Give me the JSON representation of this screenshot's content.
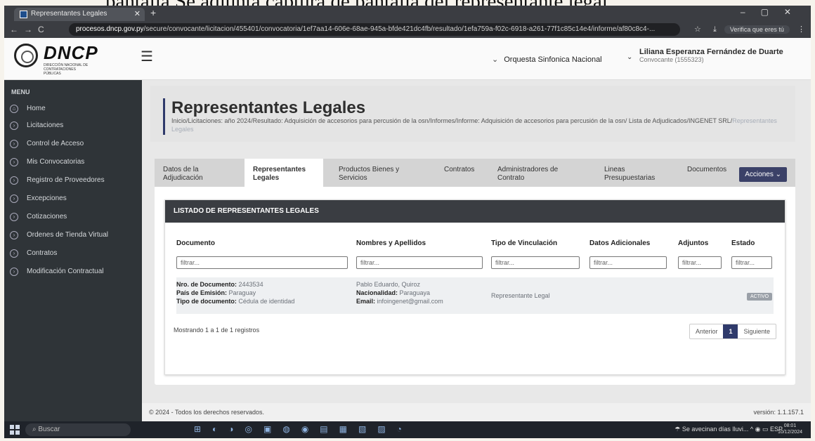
{
  "doc_heading": "pantalla Se adjunta captura de pantalla del representante legal",
  "browser": {
    "tab_title": "Representantes Legales",
    "url_host": "procesos.dncp.gov.py",
    "url_path": "/secure/convocante/licitacion/455401/convocatoria/1ef7aa14-606e-68ae-945a-bfde421dc4fb/resultado/1efa759a-f02c-6918-a261-77f1c85c14e4/informe/af80c8c4-...",
    "verify_label": "Verifica que eres tú"
  },
  "header": {
    "brand": "DNCP",
    "brand_sub": "DIRECCIÓN NACIONAL DE CONTRATACIONES PÚBLICAS",
    "org": "Orquesta Sinfonica Nacional",
    "user_name": "Liliana Esperanza Fernández de Duarte",
    "user_role": "Convocante (1555323)"
  },
  "sidebar": {
    "title": "MENU",
    "items": [
      {
        "label": "Home"
      },
      {
        "label": "Licitaciones"
      },
      {
        "label": "Control de Acceso"
      },
      {
        "label": "Mis Convocatorias"
      },
      {
        "label": "Registro de Proveedores"
      },
      {
        "label": "Excepciones"
      },
      {
        "label": "Cotizaciones"
      },
      {
        "label": "Ordenes de Tienda Virtual"
      },
      {
        "label": "Contratos"
      },
      {
        "label": "Modificación Contractual"
      }
    ]
  },
  "page": {
    "title": "Representantes Legales",
    "breadcrumb": "Inicio/Licitaciones: año 2024/Resultado: Adquisición de accesorios para percusión de la osn/Informes/Informe: Adquisición de accesorios para percusión de la osn/ Lista de Adjudicados/INGENET SRL/",
    "breadcrumb_current": "Representantes Legales"
  },
  "tabs": [
    {
      "label": "Datos de la Adjudicación"
    },
    {
      "label": "Representantes Legales"
    },
    {
      "label": "Productos Bienes y Servicios"
    },
    {
      "label": "Contratos"
    },
    {
      "label": "Administradores de Contrato"
    },
    {
      "label": "Lineas Presupuestarias"
    },
    {
      "label": "Documentos"
    }
  ],
  "actions_label": "Acciones",
  "list": {
    "title": "LISTADO DE REPRESENTANTES LEGALES",
    "columns": [
      "Documento",
      "Nombres y Apellidos",
      "Tipo de Vinculación",
      "Datos Adicionales",
      "Adjuntos",
      "Estado"
    ],
    "filter_placeholder": "filtrar...",
    "row": {
      "doc_label": "Nro. de Documento:",
      "doc_value": "2443534",
      "pais_label": "País de Emisión:",
      "pais_value": "Paraguay",
      "tipo_label": "Tipo de documento:",
      "tipo_value": "Cédula de identidad",
      "name": "Pablo Eduardo, Quiroz",
      "nac_label": "Nacionalidad:",
      "nac_value": "Paraguaya",
      "email_label": "Email:",
      "email_value": "infoingenet@gmail.com",
      "vinculacion": "Representante Legal",
      "estado": "ACTIVO"
    },
    "showing": "Mostrando 1 a 1 de 1 registros",
    "prev": "Anterior",
    "page": "1",
    "next": "Siguiente"
  },
  "footer": {
    "copyright": "© 2024 - Todos los derechos reservados.",
    "version": "versión: 1.1.157.1"
  },
  "taskbar": {
    "search": "Buscar",
    "weather": "Se avecinan días lluvi...",
    "lang": "ESP",
    "time": "08:01",
    "date": "10/12/2024"
  }
}
